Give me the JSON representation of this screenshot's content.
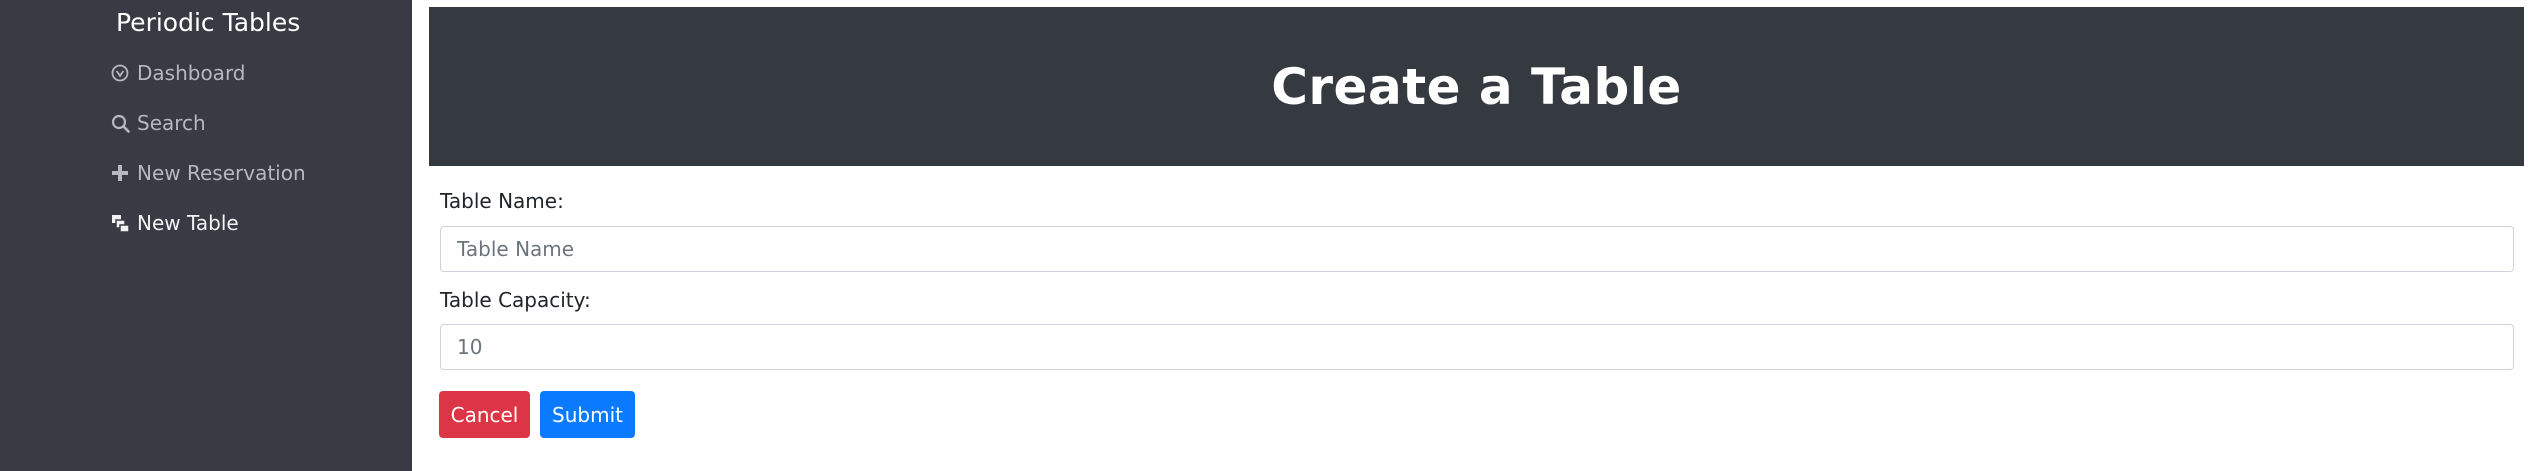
{
  "sidebar": {
    "brand": "Periodic Tables",
    "items": [
      {
        "label": "Dashboard",
        "icon": "dashboard-icon",
        "active": false
      },
      {
        "label": "Search",
        "icon": "search-icon",
        "active": false
      },
      {
        "label": "New Reservation",
        "icon": "plus-icon",
        "active": false
      },
      {
        "label": "New Table",
        "icon": "tables-icon",
        "active": true
      }
    ]
  },
  "header": {
    "title": "Create a Table"
  },
  "form": {
    "table_name": {
      "label": "Table Name:",
      "placeholder": "Table Name",
      "value": ""
    },
    "table_capacity": {
      "label": "Table Capacity:",
      "placeholder": "10",
      "value": ""
    },
    "cancel_label": "Cancel",
    "submit_label": "Submit"
  },
  "colors": {
    "sidebar_bg": "#3a3a44",
    "header_bg": "#353a40",
    "cancel": "#dc3545",
    "submit": "#0a7bff"
  }
}
